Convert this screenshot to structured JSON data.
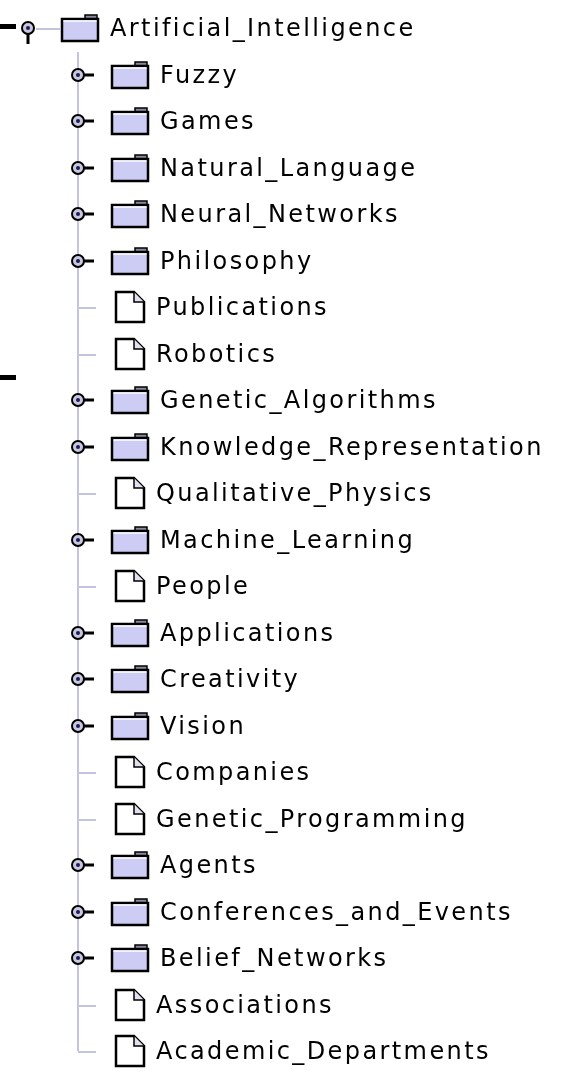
{
  "tree": {
    "label": "Artificial_Intelligence",
    "kind": "folder",
    "expanded": true,
    "children": [
      {
        "label": "Fuzzy",
        "kind": "folder",
        "expanded": false
      },
      {
        "label": "Games",
        "kind": "folder",
        "expanded": false
      },
      {
        "label": "Natural_Language",
        "kind": "folder",
        "expanded": false
      },
      {
        "label": "Neural_Networks",
        "kind": "folder",
        "expanded": false
      },
      {
        "label": "Philosophy",
        "kind": "folder",
        "expanded": false
      },
      {
        "label": "Publications",
        "kind": "leaf"
      },
      {
        "label": "Robotics",
        "kind": "leaf"
      },
      {
        "label": "Genetic_Algorithms",
        "kind": "folder",
        "expanded": false
      },
      {
        "label": "Knowledge_Representation",
        "kind": "folder",
        "expanded": false
      },
      {
        "label": "Qualitative_Physics",
        "kind": "leaf"
      },
      {
        "label": "Machine_Learning",
        "kind": "folder",
        "expanded": false
      },
      {
        "label": "People",
        "kind": "leaf"
      },
      {
        "label": "Applications",
        "kind": "folder",
        "expanded": false
      },
      {
        "label": "Creativity",
        "kind": "folder",
        "expanded": false
      },
      {
        "label": "Vision",
        "kind": "folder",
        "expanded": false
      },
      {
        "label": "Companies",
        "kind": "leaf"
      },
      {
        "label": "Genetic_Programming",
        "kind": "leaf"
      },
      {
        "label": "Agents",
        "kind": "folder",
        "expanded": false
      },
      {
        "label": "Conferences_and_Events",
        "kind": "folder",
        "expanded": false
      },
      {
        "label": "Belief_Networks",
        "kind": "folder",
        "expanded": false
      },
      {
        "label": "Associations",
        "kind": "leaf"
      },
      {
        "label": "Academic_Departments",
        "kind": "leaf"
      }
    ]
  }
}
